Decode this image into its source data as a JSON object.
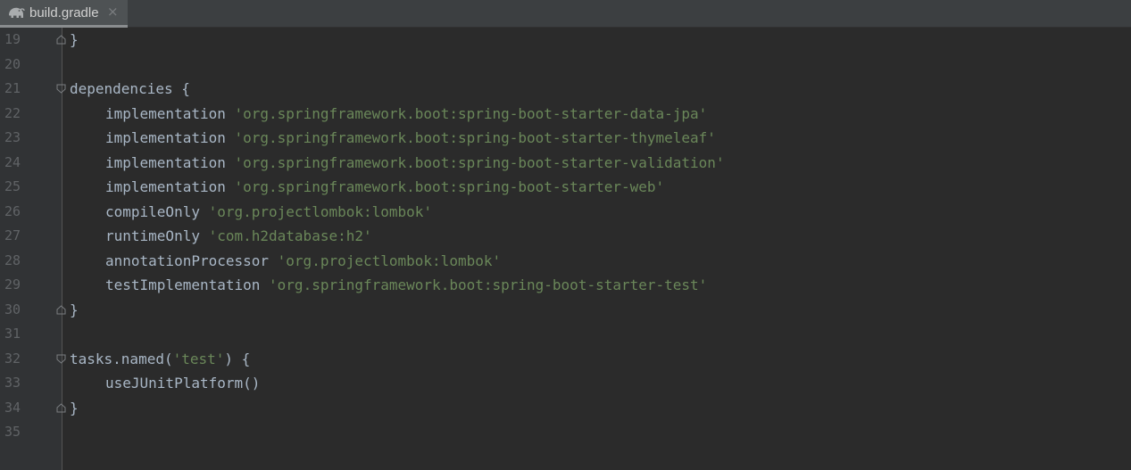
{
  "tab": {
    "label": "build.gradle",
    "icon": "gradle-elephant-icon",
    "close_glyph": "×"
  },
  "colors": {
    "background": "#2b2b2b",
    "gutter": "#313335",
    "text": "#a9b7c6",
    "string": "#6a8759",
    "line_number": "#606366"
  },
  "lines": [
    {
      "num": "19",
      "fold": "end",
      "indent": 0,
      "segments": [
        {
          "t": "}",
          "s": false
        }
      ]
    },
    {
      "num": "20",
      "fold": "",
      "indent": 0,
      "segments": []
    },
    {
      "num": "21",
      "fold": "start",
      "indent": 0,
      "segments": [
        {
          "t": "dependencies {",
          "s": false
        }
      ]
    },
    {
      "num": "22",
      "fold": "",
      "indent": 1,
      "segments": [
        {
          "t": "implementation ",
          "s": false
        },
        {
          "t": "'org.springframework.boot:spring-boot-starter-data-jpa'",
          "s": true
        }
      ]
    },
    {
      "num": "23",
      "fold": "",
      "indent": 1,
      "segments": [
        {
          "t": "implementation ",
          "s": false
        },
        {
          "t": "'org.springframework.boot:spring-boot-starter-thymeleaf'",
          "s": true
        }
      ]
    },
    {
      "num": "24",
      "fold": "",
      "indent": 1,
      "segments": [
        {
          "t": "implementation ",
          "s": false
        },
        {
          "t": "'org.springframework.boot:spring-boot-starter-validation'",
          "s": true
        }
      ]
    },
    {
      "num": "25",
      "fold": "",
      "indent": 1,
      "segments": [
        {
          "t": "implementation ",
          "s": false
        },
        {
          "t": "'org.springframework.boot:spring-boot-starter-web'",
          "s": true
        }
      ]
    },
    {
      "num": "26",
      "fold": "",
      "indent": 1,
      "segments": [
        {
          "t": "compileOnly ",
          "s": false
        },
        {
          "t": "'org.projectlombok:lombok'",
          "s": true
        }
      ]
    },
    {
      "num": "27",
      "fold": "",
      "indent": 1,
      "segments": [
        {
          "t": "runtimeOnly ",
          "s": false
        },
        {
          "t": "'com.h2database:h2'",
          "s": true
        }
      ]
    },
    {
      "num": "28",
      "fold": "",
      "indent": 1,
      "segments": [
        {
          "t": "annotationProcessor ",
          "s": false
        },
        {
          "t": "'org.projectlombok:lombok'",
          "s": true
        }
      ]
    },
    {
      "num": "29",
      "fold": "",
      "indent": 1,
      "segments": [
        {
          "t": "testImplementation ",
          "s": false
        },
        {
          "t": "'org.springframework.boot:spring-boot-starter-test'",
          "s": true
        }
      ]
    },
    {
      "num": "30",
      "fold": "end",
      "indent": 0,
      "segments": [
        {
          "t": "}",
          "s": false
        }
      ]
    },
    {
      "num": "31",
      "fold": "",
      "indent": 0,
      "segments": []
    },
    {
      "num": "32",
      "fold": "start",
      "indent": 0,
      "segments": [
        {
          "t": "tasks.named(",
          "s": false
        },
        {
          "t": "'test'",
          "s": true
        },
        {
          "t": ") {",
          "s": false
        }
      ]
    },
    {
      "num": "33",
      "fold": "",
      "indent": 1,
      "segments": [
        {
          "t": "useJUnitPlatform()",
          "s": false
        }
      ]
    },
    {
      "num": "34",
      "fold": "end",
      "indent": 0,
      "segments": [
        {
          "t": "}",
          "s": false
        }
      ]
    },
    {
      "num": "35",
      "fold": "",
      "indent": 0,
      "segments": []
    }
  ]
}
